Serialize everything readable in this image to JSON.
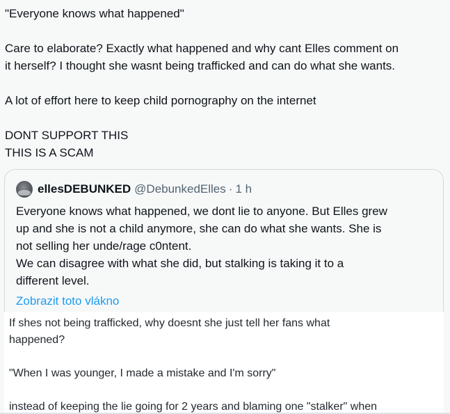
{
  "main_tweet": {
    "lines": [
      "\"Everyone knows what happened\"",
      "",
      "Care to elaborate? Exactly what happened and why cant Elles comment on",
      "it herself? I thought she wasnt being trafficked and can do what she wants.",
      "",
      "A lot of effort here to keep child pornography on the internet",
      "",
      "DONT SUPPORT THIS",
      "THIS IS A SCAM"
    ]
  },
  "quote": {
    "display_name": "ellesDEBUNKED",
    "handle": "@DebunkedElles",
    "separator": "·",
    "time": "1 h",
    "lines": [
      "Everyone knows what happened, we dont lie to anyone. But Elles grew",
      "up and she is not a child anymore, she can do what she wants. She is",
      "not selling her unde/rage c0ntent.",
      "We can disagree with what she did, but stalking is taking it to a",
      "different level."
    ],
    "show_thread_label": "Zobrazit toto vlákno"
  },
  "reply": {
    "lines": [
      "If shes not being trafficked, why doesnt she just tell her fans what",
      "happened?",
      "",
      "\"When I was younger, I made a mistake and I'm sorry\"",
      "",
      "instead of keeping the lie going for 2 years and blaming one \"stalker\" when"
    ]
  }
}
